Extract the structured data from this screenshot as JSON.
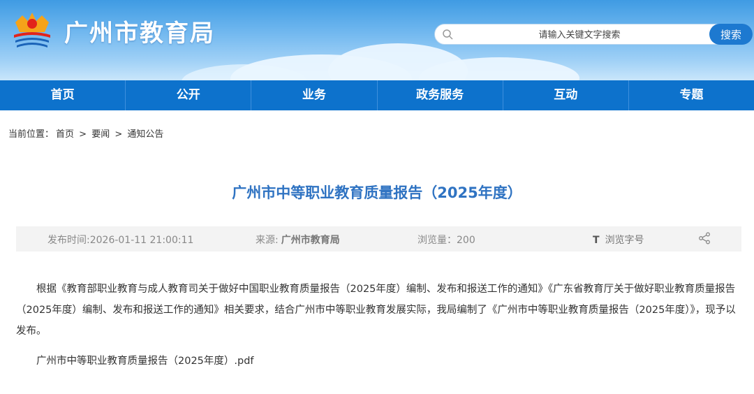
{
  "header": {
    "site_title": "广州市教育局",
    "logo_icon": "education-bureau-logo-icon",
    "search": {
      "placeholder": "请输入关键文字搜索",
      "button_label": "搜索"
    }
  },
  "nav": {
    "items": [
      "首页",
      "公开",
      "业务",
      "政务服务",
      "互动",
      "专题"
    ]
  },
  "breadcrumb": {
    "label": "当前位置：",
    "items": [
      "首页",
      "要闻",
      "通知公告"
    ],
    "separator": ">"
  },
  "article": {
    "title": "广州市中等职业教育质量报告（2025年度）",
    "meta": {
      "publish_time": "发布时间:2026-01-11 21:00:11",
      "source_label": "来源:",
      "source_value": "广州市教育局",
      "views": "浏览量：200",
      "font_label": "浏览字号",
      "font_icon": "T"
    },
    "body": "根据《教育部职业教育与成人教育司关于做好中国职业教育质量报告（2025年度）编制、发布和报送工作的通知》《广东省教育厅关于做好职业教育质量报告（2025年度）编制、发布和报送工作的通知》相关要求，结合广州市中等职业教育发展实际，我局编制了《广州市中等职业教育质量报告（2025年度）》，现予以发布。",
    "attachment": "广州市中等职业教育质量报告（2025年度）.pdf"
  },
  "colors": {
    "nav_bg": "#0d72cc",
    "title_blue": "#2f73c2",
    "search_button": "#1d79d0"
  }
}
